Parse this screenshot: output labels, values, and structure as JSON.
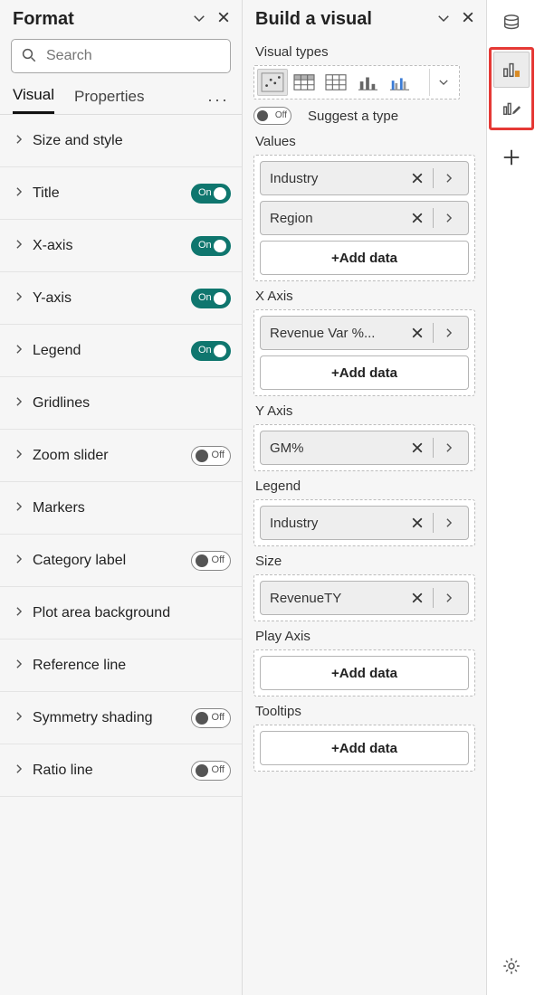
{
  "format_pane": {
    "title": "Format",
    "search_placeholder": "Search",
    "tabs": {
      "visual": "Visual",
      "properties": "Properties"
    },
    "items": [
      {
        "label": "Size and style",
        "toggle": null
      },
      {
        "label": "Title",
        "toggle": "on"
      },
      {
        "label": "X-axis",
        "toggle": "on"
      },
      {
        "label": "Y-axis",
        "toggle": "on"
      },
      {
        "label": "Legend",
        "toggle": "on"
      },
      {
        "label": "Gridlines",
        "toggle": null
      },
      {
        "label": "Zoom slider",
        "toggle": "off"
      },
      {
        "label": "Markers",
        "toggle": null
      },
      {
        "label": "Category label",
        "toggle": "off"
      },
      {
        "label": "Plot area background",
        "toggle": null
      },
      {
        "label": "Reference line",
        "toggle": null
      },
      {
        "label": "Symmetry shading",
        "toggle": "off"
      },
      {
        "label": "Ratio line",
        "toggle": "off"
      }
    ],
    "toggle_text": {
      "on": "On",
      "off": "Off"
    }
  },
  "build_pane": {
    "title": "Build a visual",
    "visual_types_label": "Visual types",
    "suggest": {
      "toggle_text": "Off",
      "label": "Suggest a type"
    },
    "add_data_label": "+Add data",
    "wells": [
      {
        "label": "Values",
        "fields": [
          "Industry",
          "Region"
        ],
        "add": true
      },
      {
        "label": "X Axis",
        "fields": [
          "Revenue Var %..."
        ],
        "add": true
      },
      {
        "label": "Y Axis",
        "fields": [
          "GM%"
        ],
        "add": false
      },
      {
        "label": "Legend",
        "fields": [
          "Industry"
        ],
        "add": false
      },
      {
        "label": "Size",
        "fields": [
          "RevenueTY"
        ],
        "add": false
      },
      {
        "label": "Play Axis",
        "fields": [],
        "add": true
      },
      {
        "label": "Tooltips",
        "fields": [],
        "add": true
      }
    ]
  }
}
